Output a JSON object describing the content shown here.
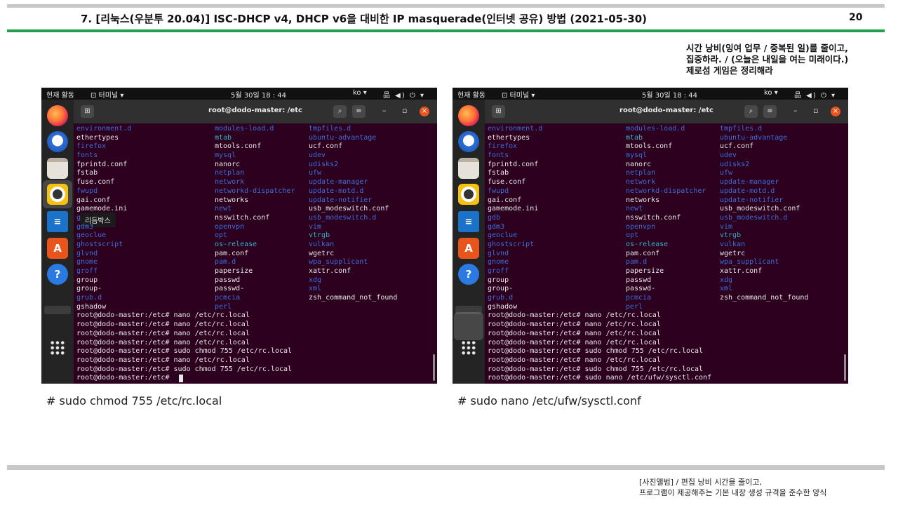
{
  "slide": {
    "title": "7. [리눅스(우분투 20.04)] ISC-DHCP v4, DHCP v6을 대비한 IP masquerade(인터넷 공유) 방법 (2021-05-30)",
    "page_number": "20",
    "motto": [
      "시간 낭비(잉여 업무 / 중복된 일)를 줄이고,",
      "집중하라. / (오늘은 내일을 여는 미래이다.)",
      "제로섬 게임은 정리해라"
    ],
    "footer": [
      "[사진앨범] / 편집 낭비 시간을 줄이고,",
      "프로그램이 제공해주는 기본 내장 생성 규격을 준수한 양식"
    ],
    "colors": {
      "accent_green": "#21a14b",
      "rule_gray": "#c8c8c8",
      "terminal_bg": "#2c001e"
    }
  },
  "screenshots": [
    {
      "caption": "# sudo chmod 755 /etc/rc.local",
      "topbar": {
        "activities": "현재 활동",
        "app_menu": "⊡ 터미널 ▾",
        "clock": "5월 30일 18 : 44",
        "lang": "ko ▾",
        "status": "品 ◀) ⏻ ▾"
      },
      "window_title": "root@dodo-master: /etc",
      "dock_tooltip": "리듬박스",
      "dock_icons": [
        "firefox-icon",
        "thunderbird-icon",
        "files-icon",
        "rhythmbox-icon",
        "writer-icon",
        "software-icon",
        "help-icon",
        "apps-grid-icon"
      ],
      "listing": [
        [
          {
            "t": "environment.d",
            "s": "blue"
          },
          {
            "t": "modules-load.d",
            "s": "blue"
          },
          {
            "t": "tmpfiles.d",
            "s": "blue"
          }
        ],
        [
          {
            "t": "ethertypes",
            "s": ""
          },
          {
            "t": "mtab",
            "s": "cyan"
          },
          {
            "t": "ubuntu-advantage",
            "s": "blue"
          }
        ],
        [
          {
            "t": "firefox",
            "s": "blue"
          },
          {
            "t": "mtools.conf",
            "s": ""
          },
          {
            "t": "ucf.conf",
            "s": ""
          }
        ],
        [
          {
            "t": "fonts",
            "s": "blue"
          },
          {
            "t": "mysql",
            "s": "blue"
          },
          {
            "t": "udev",
            "s": "blue"
          }
        ],
        [
          {
            "t": "fprintd.conf",
            "s": ""
          },
          {
            "t": "nanorc",
            "s": ""
          },
          {
            "t": "udisks2",
            "s": "blue"
          }
        ],
        [
          {
            "t": "fstab",
            "s": ""
          },
          {
            "t": "netplan",
            "s": "blue"
          },
          {
            "t": "ufw",
            "s": "blue"
          }
        ],
        [
          {
            "t": "fuse.conf",
            "s": ""
          },
          {
            "t": "network",
            "s": "blue"
          },
          {
            "t": "update-manager",
            "s": "blue"
          }
        ],
        [
          {
            "t": "fwupd",
            "s": "blue"
          },
          {
            "t": "networkd-dispatcher",
            "s": "blue"
          },
          {
            "t": "update-motd.d",
            "s": "blue"
          }
        ],
        [
          {
            "t": "gai.conf",
            "s": ""
          },
          {
            "t": "networks",
            "s": ""
          },
          {
            "t": "update-notifier",
            "s": "blue"
          }
        ],
        [
          {
            "t": "gamemode.ini",
            "s": ""
          },
          {
            "t": "newt",
            "s": "blue"
          },
          {
            "t": "usb_modeswitch.conf",
            "s": ""
          }
        ],
        [
          {
            "t": "g",
            "s": "blue"
          },
          {
            "t": "nsswitch.conf",
            "s": ""
          },
          {
            "t": "usb_modeswitch.d",
            "s": "blue"
          }
        ],
        [
          {
            "t": "gdm3",
            "s": "blue"
          },
          {
            "t": "openvpn",
            "s": "blue"
          },
          {
            "t": "vim",
            "s": "blue"
          }
        ],
        [
          {
            "t": "geoclue",
            "s": "blue"
          },
          {
            "t": "opt",
            "s": "blue"
          },
          {
            "t": "vtrgb",
            "s": "cyan"
          }
        ],
        [
          {
            "t": "ghostscript",
            "s": "blue"
          },
          {
            "t": "os-release",
            "s": "cyan"
          },
          {
            "t": "vulkan",
            "s": "blue"
          }
        ],
        [
          {
            "t": "glvnd",
            "s": "blue"
          },
          {
            "t": "pam.conf",
            "s": ""
          },
          {
            "t": "wgetrc",
            "s": ""
          }
        ],
        [
          {
            "t": "gnome",
            "s": "blue"
          },
          {
            "t": "pam.d",
            "s": "blue"
          },
          {
            "t": "wpa_supplicant",
            "s": "blue"
          }
        ],
        [
          {
            "t": "groff",
            "s": "blue"
          },
          {
            "t": "papersize",
            "s": ""
          },
          {
            "t": "xattr.conf",
            "s": ""
          }
        ],
        [
          {
            "t": "group",
            "s": ""
          },
          {
            "t": "passwd",
            "s": ""
          },
          {
            "t": "xdg",
            "s": "blue"
          }
        ],
        [
          {
            "t": "group-",
            "s": ""
          },
          {
            "t": "passwd-",
            "s": ""
          },
          {
            "t": "xml",
            "s": "blue"
          }
        ],
        [
          {
            "t": "grub.d",
            "s": "blue"
          },
          {
            "t": "pcmcia",
            "s": "blue"
          },
          {
            "t": "zsh_command_not_found",
            "s": ""
          }
        ],
        [
          {
            "t": "gshadow",
            "s": ""
          },
          {
            "t": "perl",
            "s": "blue"
          },
          {
            "t": "",
            "s": ""
          }
        ]
      ],
      "commands": [
        "root@dodo-master:/etc# nano /etc/rc.local",
        "root@dodo-master:/etc# nano /etc/rc.local",
        "root@dodo-master:/etc# nano /etc/rc.local",
        "root@dodo-master:/etc# nano /etc/rc.local",
        "root@dodo-master:/etc# sudo chmod 755 /etc/rc.local",
        "root@dodo-master:/etc# nano /etc/rc.local",
        "root@dodo-master:/etc# sudo chmod 755 /etc/rc.local",
        "root@dodo-master:/etc# "
      ]
    },
    {
      "caption": "# sudo nano /etc/ufw/sysctl.conf",
      "topbar": {
        "activities": "현재 활동",
        "app_menu": "⊡ 터미널 ▾",
        "clock": "5월 30일 18 : 44",
        "lang": "ko ▾",
        "status": "品 ◀) ⏻ ▾"
      },
      "window_title": "root@dodo-master: /etc",
      "dock_tooltip": "",
      "dock_icons": [
        "firefox-icon",
        "thunderbird-icon",
        "files-icon",
        "rhythmbox-icon",
        "writer-icon",
        "software-icon",
        "help-icon",
        "apps-grid-icon"
      ],
      "listing": [
        [
          {
            "t": "environment.d",
            "s": "blue"
          },
          {
            "t": "modules-load.d",
            "s": "blue"
          },
          {
            "t": "tmpfiles.d",
            "s": "blue"
          }
        ],
        [
          {
            "t": "ethertypes",
            "s": ""
          },
          {
            "t": "mtab",
            "s": "cyan"
          },
          {
            "t": "ubuntu-advantage",
            "s": "blue"
          }
        ],
        [
          {
            "t": "firefox",
            "s": "blue"
          },
          {
            "t": "mtools.conf",
            "s": ""
          },
          {
            "t": "ucf.conf",
            "s": ""
          }
        ],
        [
          {
            "t": "fonts",
            "s": "blue"
          },
          {
            "t": "mysql",
            "s": "blue"
          },
          {
            "t": "udev",
            "s": "blue"
          }
        ],
        [
          {
            "t": "fprintd.conf",
            "s": ""
          },
          {
            "t": "nanorc",
            "s": ""
          },
          {
            "t": "udisks2",
            "s": "blue"
          }
        ],
        [
          {
            "t": "fstab",
            "s": ""
          },
          {
            "t": "netplan",
            "s": "blue"
          },
          {
            "t": "ufw",
            "s": "blue"
          }
        ],
        [
          {
            "t": "fuse.conf",
            "s": ""
          },
          {
            "t": "network",
            "s": "blue"
          },
          {
            "t": "update-manager",
            "s": "blue"
          }
        ],
        [
          {
            "t": "fwupd",
            "s": "blue"
          },
          {
            "t": "networkd-dispatcher",
            "s": "blue"
          },
          {
            "t": "update-motd.d",
            "s": "blue"
          }
        ],
        [
          {
            "t": "gai.conf",
            "s": ""
          },
          {
            "t": "networks",
            "s": ""
          },
          {
            "t": "update-notifier",
            "s": "blue"
          }
        ],
        [
          {
            "t": "gamemode.ini",
            "s": ""
          },
          {
            "t": "newt",
            "s": "blue"
          },
          {
            "t": "usb_modeswitch.conf",
            "s": ""
          }
        ],
        [
          {
            "t": "gdb",
            "s": "blue"
          },
          {
            "t": "nsswitch.conf",
            "s": ""
          },
          {
            "t": "usb_modeswitch.d",
            "s": "blue"
          }
        ],
        [
          {
            "t": "gdm3",
            "s": "blue"
          },
          {
            "t": "openvpn",
            "s": "blue"
          },
          {
            "t": "vim",
            "s": "blue"
          }
        ],
        [
          {
            "t": "geoclue",
            "s": "blue"
          },
          {
            "t": "opt",
            "s": "blue"
          },
          {
            "t": "vtrgb",
            "s": "cyan"
          }
        ],
        [
          {
            "t": "ghostscript",
            "s": "blue"
          },
          {
            "t": "os-release",
            "s": "cyan"
          },
          {
            "t": "vulkan",
            "s": "blue"
          }
        ],
        [
          {
            "t": "glvnd",
            "s": "blue"
          },
          {
            "t": "pam.conf",
            "s": ""
          },
          {
            "t": "wgetrc",
            "s": ""
          }
        ],
        [
          {
            "t": "gnome",
            "s": "blue"
          },
          {
            "t": "pam.d",
            "s": "blue"
          },
          {
            "t": "wpa_supplicant",
            "s": "blue"
          }
        ],
        [
          {
            "t": "groff",
            "s": "blue"
          },
          {
            "t": "papersize",
            "s": ""
          },
          {
            "t": "xattr.conf",
            "s": ""
          }
        ],
        [
          {
            "t": "group",
            "s": ""
          },
          {
            "t": "passwd",
            "s": ""
          },
          {
            "t": "xdg",
            "s": "blue"
          }
        ],
        [
          {
            "t": "group-",
            "s": ""
          },
          {
            "t": "passwd-",
            "s": ""
          },
          {
            "t": "xml",
            "s": "blue"
          }
        ],
        [
          {
            "t": "grub.d",
            "s": "blue"
          },
          {
            "t": "pcmcia",
            "s": "blue"
          },
          {
            "t": "zsh_command_not_found",
            "s": ""
          }
        ],
        [
          {
            "t": "gshadow",
            "s": ""
          },
          {
            "t": "perl",
            "s": "blue"
          },
          {
            "t": "",
            "s": ""
          }
        ]
      ],
      "commands": [
        "root@dodo-master:/etc# nano /etc/rc.local",
        "root@dodo-master:/etc# nano /etc/rc.local",
        "root@dodo-master:/etc# nano /etc/rc.local",
        "root@dodo-master:/etc# nano /etc/rc.local",
        "root@dodo-master:/etc# sudo chmod 755 /etc/rc.local",
        "root@dodo-master:/etc# nano /etc/rc.local",
        "root@dodo-master:/etc# sudo chmod 755 /etc/rc.local",
        "root@dodo-master:/etc# sudo nano /etc/ufw/sysctl.conf"
      ]
    }
  ]
}
